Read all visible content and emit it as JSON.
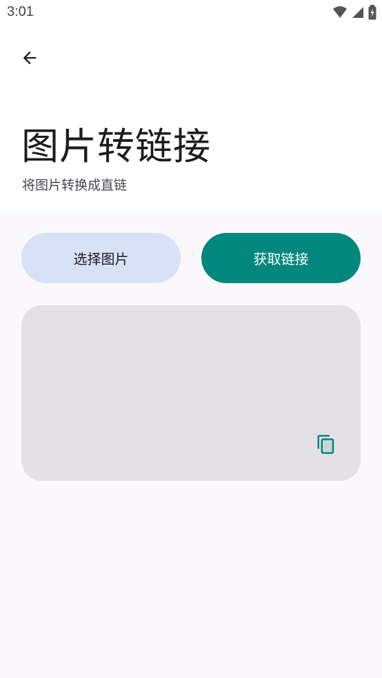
{
  "status_bar": {
    "time": "3:01"
  },
  "header": {
    "back_icon": "arrow-back-icon",
    "title": "图片转链接",
    "subtitle": "将图片转换成直链"
  },
  "actions": {
    "select_image_label": "选择图片",
    "get_link_label": "获取链接"
  },
  "result": {
    "text": "",
    "copy_icon": "copy-icon"
  },
  "colors": {
    "accent": "#00877e",
    "select_button_bg": "#d8e2f7",
    "card_bg": "#e4e1e6",
    "page_bg": "#fbf8fd"
  }
}
